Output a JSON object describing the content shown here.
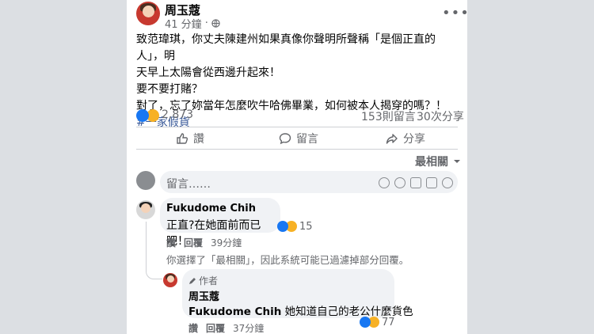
{
  "post": {
    "author": "周玉蔻",
    "time": "41 分鐘",
    "time_sep": "·",
    "lines": [
      "致范瑋琪，你丈夫陳建州如果真像你聲明所聲稱「是個正直的人」，明",
      "天早上太陽會從西邊升起來！",
      "要不要打賭？",
      "對了，忘了妳當年怎麼吹牛哈佛畢業，如何被本人揭穿的嗎？！"
    ],
    "hashtag": "#一家假貨",
    "reaction_count": "2,873",
    "comments_count": "153則留言",
    "shares_count": "30次分享"
  },
  "actions": {
    "like": "讚",
    "comment": "留言",
    "share": "分享"
  },
  "sort": {
    "label": "最相關"
  },
  "composer": {
    "placeholder": "留言……"
  },
  "comment1": {
    "author": "Fukudome Chih",
    "text": "正直?在她面前而已吧！",
    "reactions": "15",
    "like": "讚",
    "reply": "回覆",
    "time": "39分鐘"
  },
  "filter_notice": "你選擇了「最相關」，因此系統可能已過濾掉部分回覆。",
  "reply1": {
    "badge": "作者",
    "author": "周玉蔻",
    "mention": "Fukudome Chih",
    "text": " 她知道自己的老公什麼貨色",
    "reactions": "77",
    "like": "讚",
    "reply": "回覆",
    "time": "37分鐘"
  }
}
